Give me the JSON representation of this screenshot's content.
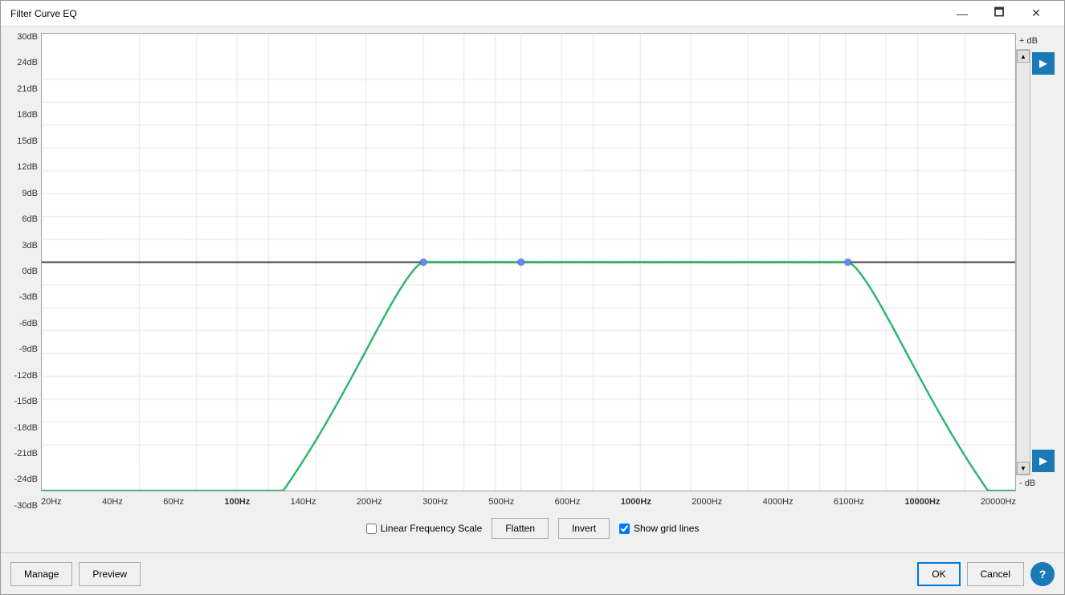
{
  "window": {
    "title": "Filter Curve EQ",
    "min_label": "—",
    "max_label": "🗖",
    "close_label": "✕"
  },
  "yAxis": {
    "labels": [
      "30dB",
      "24dB",
      "21dB",
      "18dB",
      "15dB",
      "12dB",
      "9dB",
      "6dB",
      "3dB",
      "0dB",
      "-3dB",
      "-6dB",
      "-9dB",
      "-12dB",
      "-15dB",
      "-18dB",
      "-21dB",
      "-24dB",
      "-30dB"
    ],
    "plus_label": "+ dB",
    "minus_label": "- dB"
  },
  "xAxis": {
    "labels": [
      "20Hz",
      "40Hz",
      "60Hz",
      "100Hz",
      "140Hz",
      "200Hz",
      "300Hz",
      "500Hz",
      "600Hz",
      "1000Hz",
      "2000Hz",
      "4000Hz",
      "6100Hz",
      "10000Hz",
      "20000Hz"
    ]
  },
  "controls": {
    "linear_freq_label": "Linear Frequency Scale",
    "linear_freq_checked": false,
    "flatten_label": "Flatten",
    "invert_label": "Invert",
    "show_grid_label": "Show grid lines",
    "show_grid_checked": true
  },
  "footer": {
    "manage_label": "Manage",
    "preview_label": "Preview",
    "ok_label": "OK",
    "cancel_label": "Cancel",
    "help_label": "?"
  },
  "chart": {
    "bg_color": "#ffffff",
    "grid_color": "#cccccc",
    "zero_line_color": "#000000",
    "curve_color": "#00aa44",
    "curve_color2": "#6688ff"
  }
}
